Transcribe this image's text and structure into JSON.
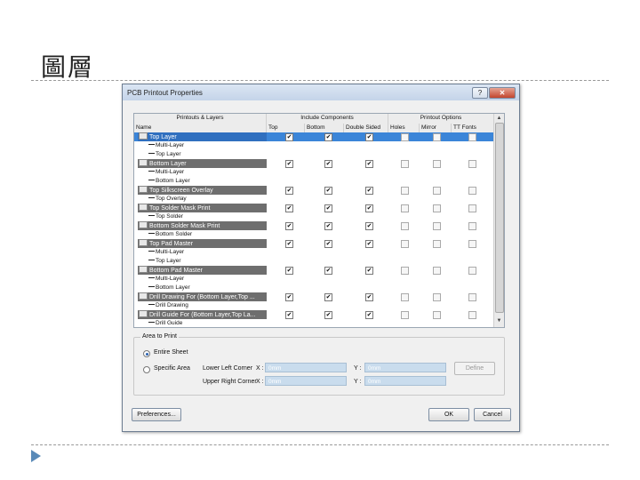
{
  "slide": {
    "title": "圖層"
  },
  "dialog": {
    "title": "PCB Printout Properties",
    "help_label": "?",
    "close_label": "✕",
    "grid": {
      "groups": [
        "Printouts & Layers",
        "Include Components",
        "Printout Options"
      ],
      "columns": [
        "Name",
        "Top",
        "Bottom",
        "Double Sided",
        "Holes",
        "Mirror",
        "TT Fonts"
      ],
      "check_glyph": "✔",
      "rows": [
        {
          "type": "printout",
          "name": "Top Layer",
          "selected": true,
          "include": [
            true,
            true,
            true
          ],
          "options": [
            false,
            false,
            false
          ]
        },
        {
          "type": "layer",
          "name": "Multi-Layer"
        },
        {
          "type": "layer",
          "name": "Top Layer"
        },
        {
          "type": "printout",
          "name": "Bottom Layer",
          "selected": false,
          "include": [
            true,
            true,
            true
          ],
          "options": [
            false,
            false,
            false
          ]
        },
        {
          "type": "layer",
          "name": "Multi-Layer"
        },
        {
          "type": "layer",
          "name": "Bottom Layer"
        },
        {
          "type": "printout",
          "name": "Top Silkscreen Overlay",
          "selected": false,
          "include": [
            true,
            true,
            true
          ],
          "options": [
            false,
            false,
            false
          ]
        },
        {
          "type": "layer",
          "name": "Top Overlay"
        },
        {
          "type": "printout",
          "name": "Top Solder Mask Print",
          "selected": false,
          "include": [
            true,
            true,
            true
          ],
          "options": [
            false,
            false,
            false
          ]
        },
        {
          "type": "layer",
          "name": "Top Solder"
        },
        {
          "type": "printout",
          "name": "Bottom Solder Mask Print",
          "selected": false,
          "include": [
            true,
            true,
            true
          ],
          "options": [
            false,
            false,
            false
          ]
        },
        {
          "type": "layer",
          "name": "Bottom Solder"
        },
        {
          "type": "printout",
          "name": "Top Pad Master",
          "selected": false,
          "include": [
            true,
            true,
            true
          ],
          "options": [
            false,
            false,
            false
          ]
        },
        {
          "type": "layer",
          "name": "Multi-Layer"
        },
        {
          "type": "layer",
          "name": "Top Layer"
        },
        {
          "type": "printout",
          "name": "Bottom Pad Master",
          "selected": false,
          "include": [
            true,
            true,
            true
          ],
          "options": [
            false,
            false,
            false
          ]
        },
        {
          "type": "layer",
          "name": "Multi-Layer"
        },
        {
          "type": "layer",
          "name": "Bottom Layer"
        },
        {
          "type": "printout",
          "name": "Drill Drawing For (Bottom Layer,Top ...",
          "selected": false,
          "include": [
            true,
            true,
            true
          ],
          "options": [
            false,
            false,
            false
          ]
        },
        {
          "type": "layer",
          "name": "Drill Drawing"
        },
        {
          "type": "printout",
          "name": "Drill Guide For (Bottom Layer,Top La...",
          "selected": false,
          "include": [
            true,
            true,
            true
          ],
          "options": [
            false,
            false,
            false
          ]
        },
        {
          "type": "layer",
          "name": "Drill Guide"
        }
      ]
    },
    "area": {
      "legend": "Area to Print",
      "entire_sheet": "Entire Sheet",
      "specific_area": "Specific Area",
      "selected": "entire_sheet",
      "lower_left_label": "Lower Left Corner",
      "upper_right_label": "Upper Right Corner",
      "x_label": "X :",
      "y_label": "Y :",
      "lower_left_x": "0mm",
      "lower_left_y": "0mm",
      "upper_right_x": "0mm",
      "upper_right_y": "0mm",
      "define_label": "Define"
    },
    "buttons": {
      "preferences": "Preferences...",
      "ok": "OK",
      "cancel": "Cancel"
    }
  }
}
